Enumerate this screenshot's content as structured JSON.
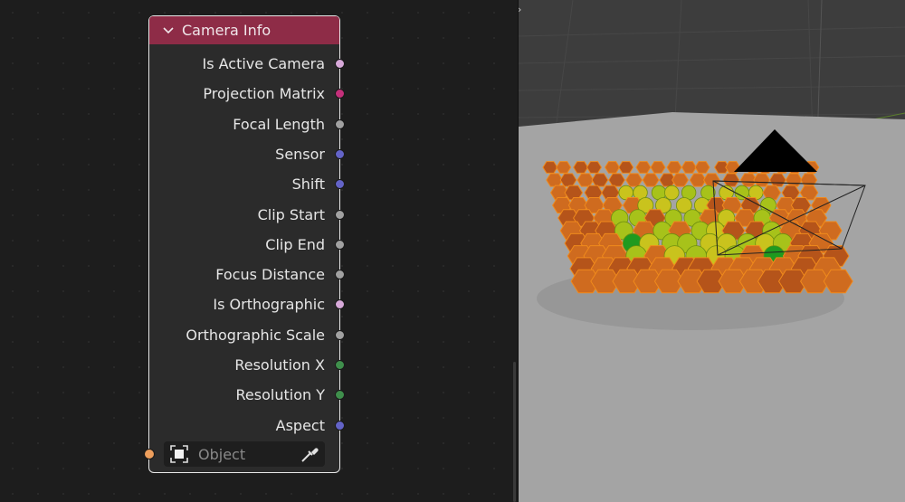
{
  "node": {
    "title": "Camera Info",
    "outputs": [
      {
        "label": "Is Active Camera",
        "color": "#d7a9d9"
      },
      {
        "label": "Projection Matrix",
        "color": "#c4307a"
      },
      {
        "label": "Focal Length",
        "color": "#a1a1a1"
      },
      {
        "label": "Sensor",
        "color": "#6363c7"
      },
      {
        "label": "Shift",
        "color": "#6363c7"
      },
      {
        "label": "Clip Start",
        "color": "#a1a1a1"
      },
      {
        "label": "Clip End",
        "color": "#a1a1a1"
      },
      {
        "label": "Focus Distance",
        "color": "#a1a1a1"
      },
      {
        "label": "Is Orthographic",
        "color": "#d7a9d9"
      },
      {
        "label": "Orthographic Scale",
        "color": "#a1a1a1"
      },
      {
        "label": "Resolution X",
        "color": "#3f8f4c"
      },
      {
        "label": "Resolution Y",
        "color": "#3f8f4c"
      },
      {
        "label": "Aspect",
        "color": "#6363c7"
      }
    ],
    "object_input": {
      "placeholder": "Object",
      "socket_color": "#ed9e5c"
    },
    "header_color": "#8e2c47"
  },
  "icons": {
    "collapse": "chevron-down-icon",
    "object": "object-icon",
    "eyedropper": "eyedropper-icon",
    "sidebar_toggle": "chevron-right-icon"
  },
  "viewport": {
    "colors": {
      "floor": "#a4a4a4",
      "background": "#3d3d3d",
      "selection": "#f08a1c"
    }
  }
}
